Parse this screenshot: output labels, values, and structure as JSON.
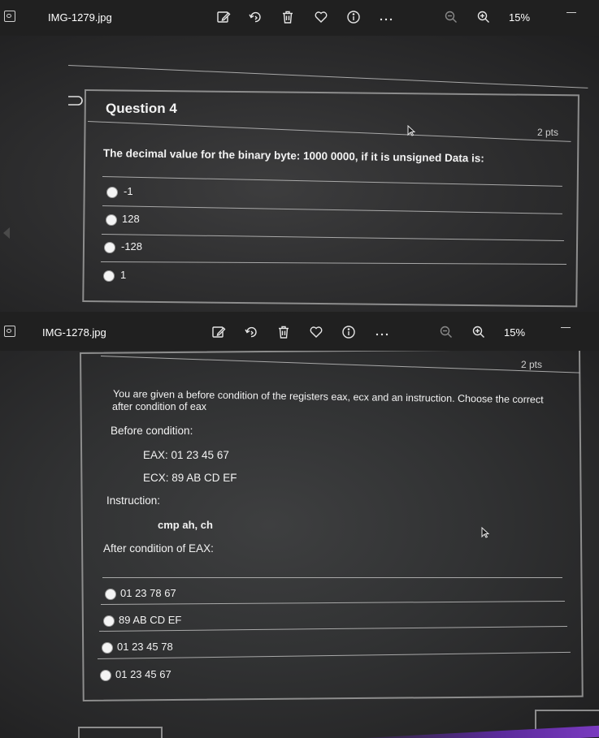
{
  "viewer1": {
    "file_title": "IMG-1279.jpg",
    "zoom": "15%",
    "question_title": "Question 4",
    "points": "2 pts",
    "question_text": "The decimal value for the binary byte: 1000 0000, if it is unsigned Data is:",
    "options": [
      "-1",
      "128",
      "-128",
      "1"
    ]
  },
  "viewer2": {
    "file_title": "IMG-1278.jpg",
    "zoom": "15%",
    "points": "2 pts",
    "question_line1": "You are given a before condition of the registers eax, ecx and an instruction. Choose the correct",
    "question_line2": "after condition of eax",
    "before_label": "Before condition:",
    "eax_line": "EAX:  01 23 45 67",
    "ecx_line": "ECX:  89 AB CD EF",
    "instruction_label": "Instruction:",
    "instruction": "cmp ah, ch",
    "after_label": "After condition of EAX:",
    "options": [
      "01 23 78 67",
      "89 AB CD EF",
      "01 23 45 78",
      "01 23 45 67"
    ]
  },
  "icons": [
    "app-icon",
    "edit-icon",
    "rotate-icon",
    "delete-icon",
    "favorite-icon",
    "info-icon",
    "more-icon",
    "zoom-out-icon",
    "zoom-in-icon",
    "minimize-icon"
  ],
  "colors": {
    "titlebar": "#202020",
    "text": "#ffffff",
    "photo_text": "#f2f2f2"
  }
}
